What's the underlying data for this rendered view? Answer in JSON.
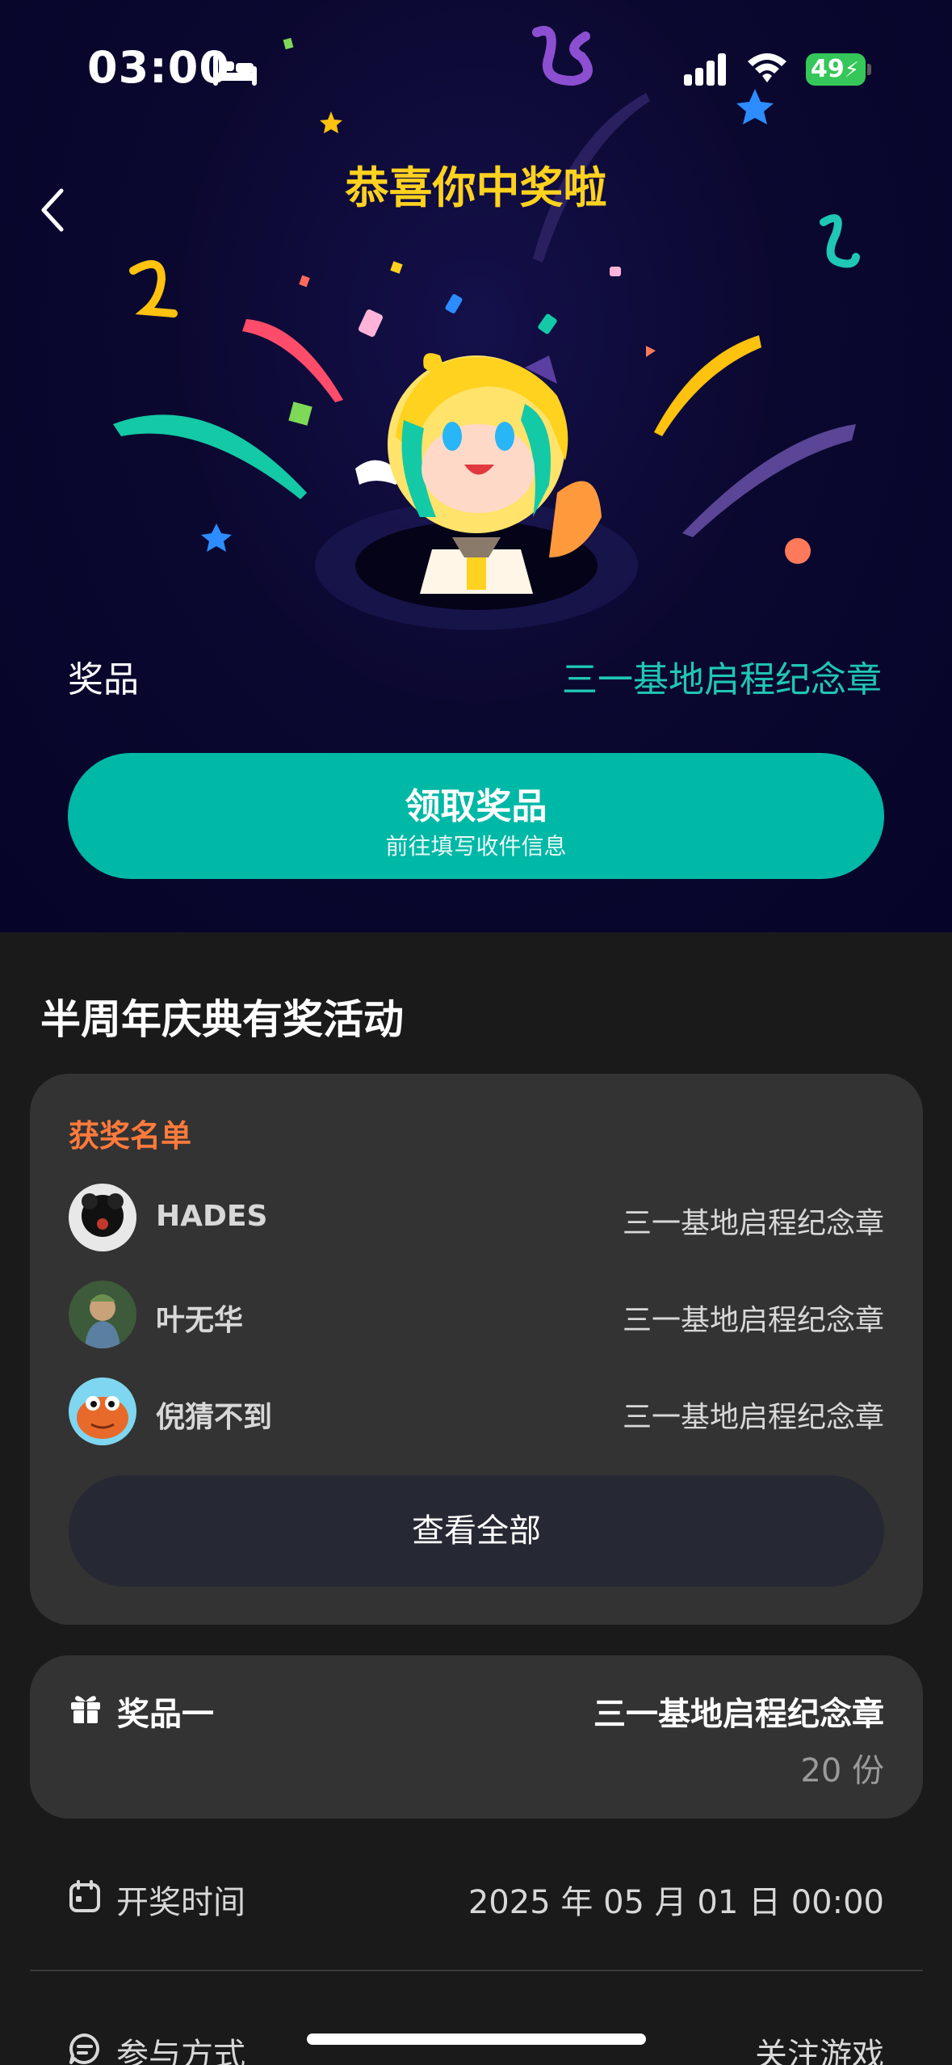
{
  "status_bar": {
    "time": "03:00",
    "battery": "49"
  },
  "hero": {
    "title": "恭喜你中奖啦",
    "prize_label": "奖品",
    "prize_name": "三一基地启程纪念章",
    "claim_button": {
      "label": "领取奖品",
      "sublabel": "前往填写收件信息"
    },
    "colors": {
      "title": "#ffd21f",
      "prize_name": "#1fc7b4",
      "claim_button": "#00b8a6"
    }
  },
  "activity": {
    "title": "半周年庆典有奖活动"
  },
  "winners": {
    "title": "获奖名单",
    "rows": [
      {
        "name": "HADES",
        "prize": "三一基地启程纪念章"
      },
      {
        "name": "叶无华",
        "prize": "三一基地启程纪念章"
      },
      {
        "name": "倪猜不到",
        "prize": "三一基地启程纪念章"
      }
    ],
    "view_all": "查看全部"
  },
  "prize_item": {
    "label": "奖品一",
    "name": "三一基地启程纪念章",
    "count": "20 份"
  },
  "draw_time": {
    "label": "开奖时间",
    "value": "2025 年 05 月 01 日 00:00"
  },
  "participation": {
    "label": "参与方式",
    "value": "关注游戏"
  }
}
